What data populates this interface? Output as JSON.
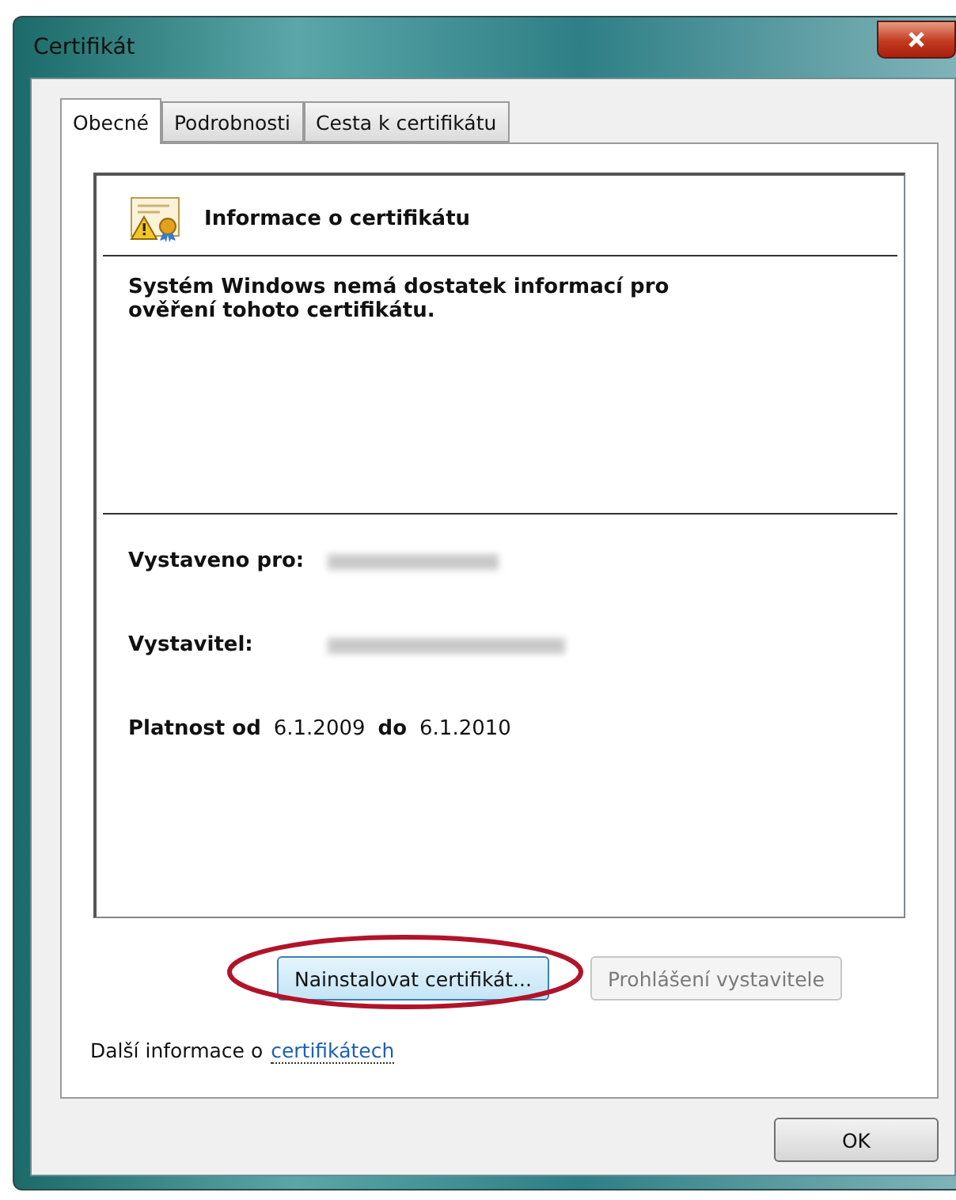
{
  "window": {
    "title": "Certifikát"
  },
  "tabs": [
    {
      "label": "Obecné",
      "selected": true
    },
    {
      "label": "Podrobnosti",
      "selected": false
    },
    {
      "label": "Cesta k certifikátu",
      "selected": false
    }
  ],
  "info": {
    "heading": "Informace o certifikátu",
    "message": "Systém Windows nemá dostatek informací pro\nověření tohoto certifikátu.",
    "issued_to_label": "Vystaveno pro:",
    "issuer_label": "Vystavitel:",
    "validity": {
      "from_label": "Platnost od",
      "from": "6.1.2009",
      "to_label": "do",
      "to": "6.1.2010"
    }
  },
  "buttons": [
    {
      "label": "Nainstalovat certifikát...",
      "disabled": false
    },
    {
      "label": "Prohlášení vystavitele",
      "disabled": true
    }
  ],
  "more_info": {
    "text": "Další informace o",
    "link": "certifikátech"
  },
  "ok_button": "OK"
}
